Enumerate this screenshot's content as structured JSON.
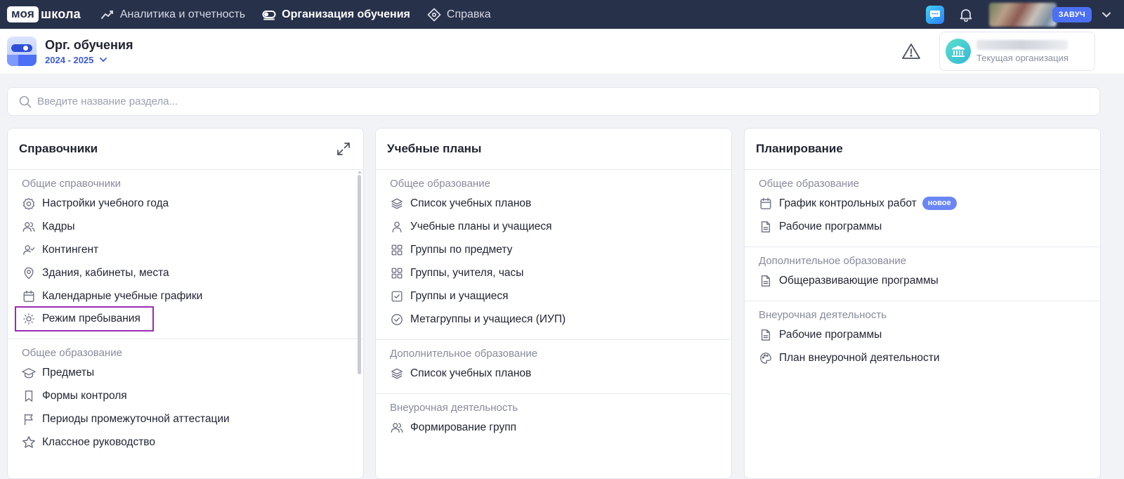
{
  "topnav": {
    "logo_moya": "моя",
    "logo_shkola": "школа",
    "items": [
      {
        "label": "Аналитика и отчетность",
        "icon": "analytics-icon",
        "active": false
      },
      {
        "label": "Организация обучения",
        "icon": "toggle-icon",
        "active": true
      },
      {
        "label": "Справка",
        "icon": "help-diamond-icon",
        "active": false
      }
    ],
    "role": "ЗАВУЧ"
  },
  "module": {
    "title": "Орг. обучения",
    "year": "2024 - 2025"
  },
  "org": {
    "label": "Текущая организация"
  },
  "search": {
    "placeholder": "Введите название раздела..."
  },
  "cards": [
    {
      "title": "Справочники",
      "sections": [
        {
          "title": "Общие справочники",
          "items": [
            {
              "label": "Настройки учебного года",
              "icon": "gear-icon"
            },
            {
              "label": "Кадры",
              "icon": "users-icon"
            },
            {
              "label": "Контингент",
              "icon": "user-check-icon"
            },
            {
              "label": "Здания, кабинеты, места",
              "icon": "map-pin-icon"
            },
            {
              "label": "Календарные учебные графики",
              "icon": "calendar-icon"
            },
            {
              "label": "Режим пребывания",
              "icon": "sun-icon",
              "highlight": true
            }
          ]
        },
        {
          "title": "Общее образование",
          "items": [
            {
              "label": "Предметы",
              "icon": "graduation-cap-icon"
            },
            {
              "label": "Формы контроля",
              "icon": "bookmark-icon"
            },
            {
              "label": "Периоды промежуточной аттестации",
              "icon": "flag-icon"
            },
            {
              "label": "Классное руководство",
              "icon": "star-icon"
            }
          ]
        }
      ]
    },
    {
      "title": "Учебные планы",
      "sections": [
        {
          "title": "Общее образование",
          "items": [
            {
              "label": "Список учебных планов",
              "icon": "layers-icon"
            },
            {
              "label": "Учебные планы и учащиеся",
              "icon": "user-icon"
            },
            {
              "label": "Группы по предмету",
              "icon": "grid-icon"
            },
            {
              "label": "Группы, учителя, часы",
              "icon": "grid-icon"
            },
            {
              "label": "Группы и учащиеся",
              "icon": "checkbox-icon"
            },
            {
              "label": "Метагруппы и учащиеся (ИУП)",
              "icon": "check-circle-icon"
            }
          ]
        },
        {
          "title": "Дополнительное образование",
          "items": [
            {
              "label": "Список учебных планов",
              "icon": "layers-icon"
            }
          ]
        },
        {
          "title": "Внеурочная деятельность",
          "items": [
            {
              "label": "Формирование групп",
              "icon": "users-icon"
            }
          ]
        }
      ]
    },
    {
      "title": "Планирование",
      "sections": [
        {
          "title": "Общее образование",
          "items": [
            {
              "label": "График контрольных работ",
              "icon": "calendar-icon",
              "badge": "новое"
            },
            {
              "label": "Рабочие программы",
              "icon": "file-icon"
            }
          ]
        },
        {
          "title": "Дополнительное образование",
          "items": [
            {
              "label": "Общеразвивающие программы",
              "icon": "file-icon"
            }
          ]
        },
        {
          "title": "Внеурочная деятельность",
          "items": [
            {
              "label": "Рабочие программы",
              "icon": "file-icon"
            },
            {
              "label": "План внеурочной деятельности",
              "icon": "palette-icon"
            }
          ]
        }
      ]
    }
  ],
  "colors": {
    "nav_bg": "#28314a",
    "accent": "#4b6ff5",
    "highlight_outline": "#9b2bb0"
  }
}
